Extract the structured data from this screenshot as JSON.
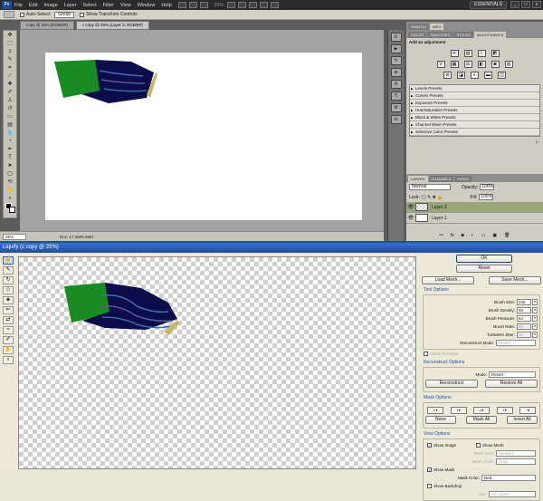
{
  "photoshop": {
    "app_logo": "Ps",
    "menu": [
      "File",
      "Edit",
      "Image",
      "Layer",
      "Select",
      "Filter",
      "View",
      "Window",
      "Help"
    ],
    "zoom_menu": "25%",
    "workspace": "ESSENTIALS",
    "window_buttons": [
      "_",
      "□",
      "x"
    ],
    "options": {
      "auto_select_label": "Auto-Select:",
      "auto_select_value": "Group",
      "transform_label": "Show Transform Controls"
    },
    "doc_tabs": [
      "copy @ 25% (RGB/8#)",
      "c copy @ 25% (Layer 2, RGB/8#)"
    ],
    "status": {
      "zoom": "25%",
      "doc": "Doc: 17.2M/5.66M"
    },
    "panel_tabs_top": [
      "SWATCH",
      "INFO"
    ],
    "adj_tabs": [
      "COLOR",
      "SWATCHES",
      "STYLES",
      "ADJUSTMENTS"
    ],
    "adjust_title": "Add an adjustment",
    "presets": [
      "Levels Presets",
      "Curves Presets",
      "Exposure Presets",
      "Hue/Saturation Presets",
      "Black & White Presets",
      "Channel Mixer Presets",
      "Selective Color Presets"
    ],
    "layers_tabs": [
      "LAYERS",
      "CHANNELS",
      "PATHS"
    ],
    "blend_mode": "Normal",
    "opacity_label": "Opacity:",
    "opacity_value": "100%",
    "lock_label": "Lock:",
    "fill_label": "Fill:",
    "fill_value": "100%",
    "layers": [
      {
        "name": "Layer 2",
        "selected": true
      },
      {
        "name": "Layer 1",
        "selected": false
      }
    ]
  },
  "liquify": {
    "title": "Liquify (c copy @ 25%)",
    "ok": "OK",
    "reset": "Reset",
    "load_mesh": "Load Mesh...",
    "save_mesh": "Save Mesh...",
    "tool_options": {
      "title": "Tool Options",
      "brush_size_label": "Brush Size:",
      "brush_size": "226",
      "brush_density_label": "Brush Density:",
      "brush_density": "49",
      "brush_pressure_label": "Brush Pressure:",
      "brush_pressure": "64",
      "brush_rate_label": "Brush Rate:",
      "brush_rate": "80",
      "turbulent_label": "Turbulent Jitter:",
      "turbulent": "50",
      "recon_mode_label": "Reconstruct Mode:",
      "recon_mode": "Revert",
      "stylus_label": "Stylus Pressure"
    },
    "reconstruct": {
      "title": "Reconstruct Options",
      "mode_label": "Mode:",
      "mode": "Revert",
      "reconstruct_btn": "Reconstruct",
      "restore_btn": "Restore All"
    },
    "mask": {
      "title": "Mask Options",
      "none": "None",
      "mask_all": "Mask All",
      "invert_all": "Invert All"
    },
    "view": {
      "title": "View Options",
      "show_image": "Show Image",
      "show_mesh": "Show Mesh",
      "mesh_size_label": "Mesh Size:",
      "mesh_size": "Medium",
      "mesh_color_label": "Mesh Color:",
      "mesh_color": "Gray",
      "show_mask": "Show Mask",
      "mask_color_label": "Mask Color:",
      "mask_color": "Red",
      "show_backdrop": "Show Backdrop",
      "use_label": "Use:",
      "use_value": "All Layers"
    }
  },
  "colors": {
    "green": "#1a8a22",
    "navy": "#0a0d4a",
    "tan": "#c9b46a",
    "selected_layer": "#9aa57a",
    "title_blue": "#1f4ea3"
  }
}
